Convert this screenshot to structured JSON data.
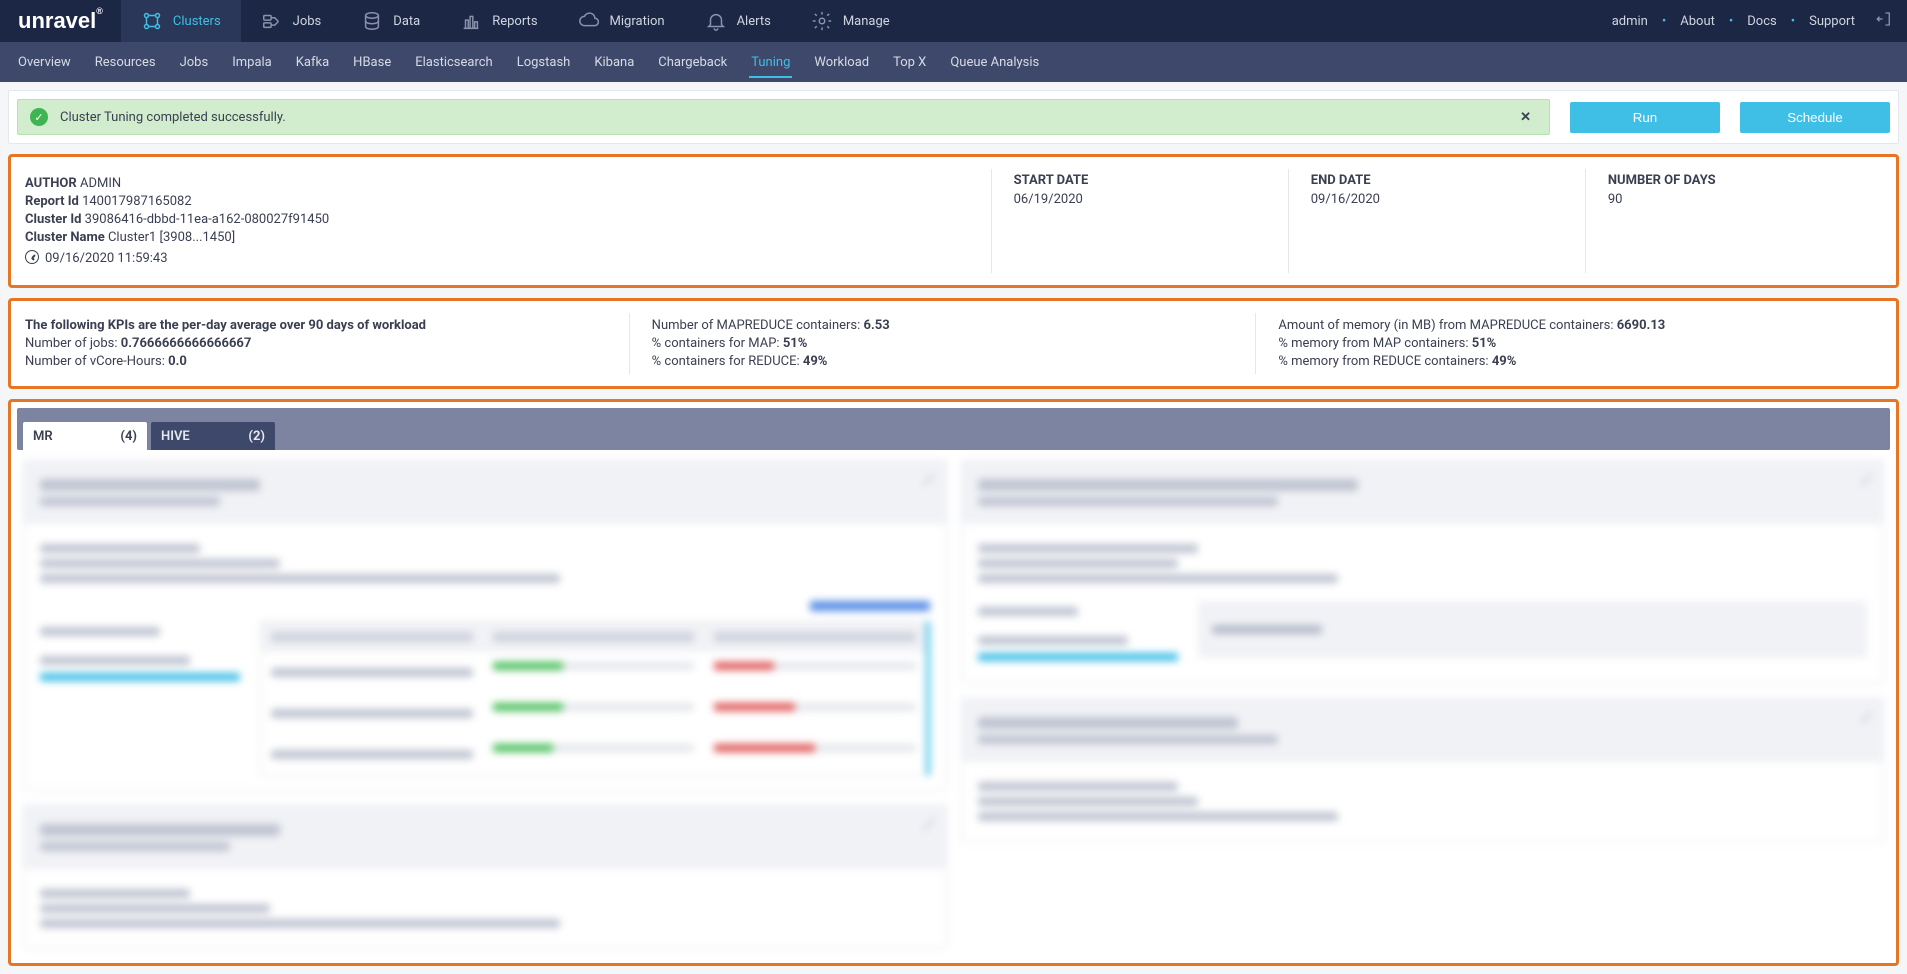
{
  "brand": "unravel",
  "topnav": {
    "items": [
      {
        "label": "Clusters"
      },
      {
        "label": "Jobs"
      },
      {
        "label": "Data"
      },
      {
        "label": "Reports"
      },
      {
        "label": "Migration"
      },
      {
        "label": "Alerts"
      },
      {
        "label": "Manage"
      }
    ],
    "right": {
      "user": "admin",
      "about": "About",
      "docs": "Docs",
      "support": "Support"
    }
  },
  "subnav": {
    "items": [
      {
        "label": "Overview"
      },
      {
        "label": "Resources"
      },
      {
        "label": "Jobs"
      },
      {
        "label": "Impala"
      },
      {
        "label": "Kafka"
      },
      {
        "label": "HBase"
      },
      {
        "label": "Elasticsearch"
      },
      {
        "label": "Logstash"
      },
      {
        "label": "Kibana"
      },
      {
        "label": "Chargeback"
      },
      {
        "label": "Tuning"
      },
      {
        "label": "Workload"
      },
      {
        "label": "Top X"
      },
      {
        "label": "Queue Analysis"
      }
    ],
    "active": "Tuning"
  },
  "alert": {
    "text": "Cluster Tuning completed successfully."
  },
  "buttons": {
    "run": "Run",
    "schedule": "Schedule"
  },
  "meta": {
    "author_label": "AUTHOR",
    "author": "ADMIN",
    "report_id_label": "Report Id",
    "report_id": "140017987165082",
    "cluster_id_label": "Cluster Id",
    "cluster_id": "39086416-dbbd-11ea-a162-080027f91450",
    "cluster_name_label": "Cluster Name",
    "cluster_name": "Cluster1 [3908...1450]",
    "timestamp": "09/16/2020 11:59:43",
    "start_label": "START DATE",
    "start": "06/19/2020",
    "end_label": "END DATE",
    "end": "09/16/2020",
    "days_label": "NUMBER OF DAYS",
    "days": "90"
  },
  "kpi": {
    "intro": "The following KPIs are the per-day average over 90 days of workload",
    "jobs_label": "Number of jobs:",
    "jobs": "0.7666666666666667",
    "vcore_label": "Number of vCore-Hours:",
    "vcore": "0.0",
    "mr_containers_label": "Number of MAPREDUCE containers:",
    "mr_containers": "6.53",
    "pct_map_label": "% containers for MAP:",
    "pct_map": "51%",
    "pct_reduce_label": "% containers for REDUCE:",
    "pct_reduce": "49%",
    "mem_label": "Amount of memory (in MB) from MAPREDUCE containers:",
    "mem": "6690.13",
    "mem_map_label": "% memory from MAP containers:",
    "mem_map": "51%",
    "mem_reduce_label": "% memory from REDUCE containers:",
    "mem_reduce": "49%"
  },
  "tabs": {
    "mr": {
      "label": "MR",
      "count": "(4)"
    },
    "hive": {
      "label": "HIVE",
      "count": "(2)"
    }
  }
}
